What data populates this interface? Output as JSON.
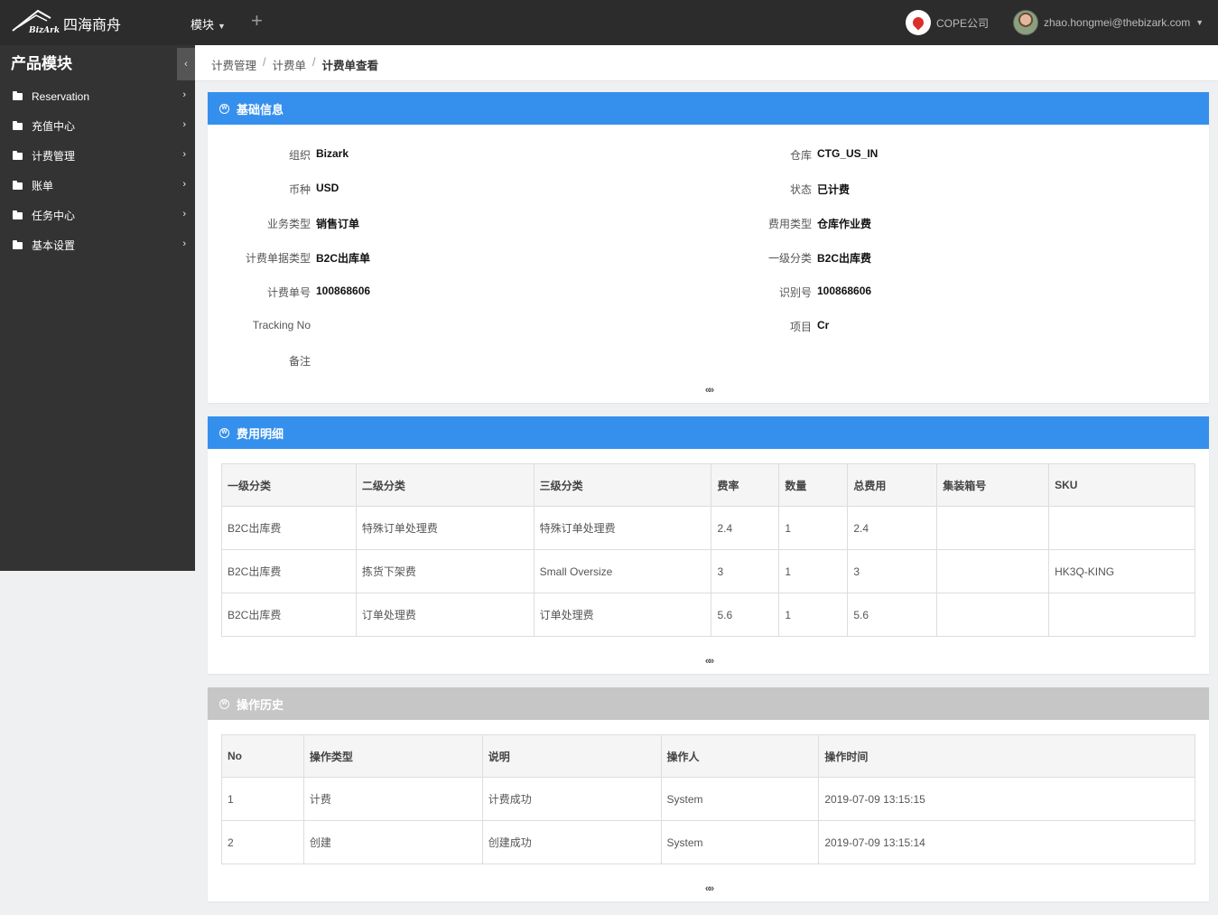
{
  "topbar": {
    "logo_brand": "BizArk",
    "logo_text": "四海商舟",
    "module_menu": "模块",
    "add_label": "+",
    "company": "COPE公司",
    "user_email": "zhao.hongmei@thebizark.com"
  },
  "sidebar": {
    "title": "产品模块",
    "collapse_label": "‹",
    "items": [
      {
        "label": "Reservation"
      },
      {
        "label": "充值中心"
      },
      {
        "label": "计费管理"
      },
      {
        "label": "账单"
      },
      {
        "label": "任务中心"
      },
      {
        "label": "基本设置"
      }
    ]
  },
  "breadcrumb": {
    "items": [
      "计费管理",
      "计费单"
    ],
    "current": "计费单查看",
    "separator": "/"
  },
  "basic_info": {
    "title": "基础信息",
    "left": [
      {
        "label": "组织",
        "value": "Bizark"
      },
      {
        "label": "币种",
        "value": "USD"
      },
      {
        "label": "业务类型",
        "value": "销售订单"
      },
      {
        "label": "计费单据类型",
        "value": "B2C出库单"
      },
      {
        "label": "计费单号",
        "value": "100868606"
      },
      {
        "label": "Tracking No",
        "value": ""
      },
      {
        "label": "备注",
        "value": ""
      }
    ],
    "right": [
      {
        "label": "仓库",
        "value": "CTG_US_IN"
      },
      {
        "label": "状态",
        "value": "已计费"
      },
      {
        "label": "费用类型",
        "value": "仓库作业费"
      },
      {
        "label": "一级分类",
        "value": "B2C出库费"
      },
      {
        "label": "识别号",
        "value": "100868606"
      },
      {
        "label": "项目",
        "value": "Cr"
      }
    ]
  },
  "fee_detail": {
    "title": "费用明细",
    "columns": [
      "一级分类",
      "二级分类",
      "三级分类",
      "费率",
      "数量",
      "总费用",
      "集装箱号",
      "SKU"
    ],
    "rows": [
      [
        "B2C出库费",
        "特殊订单处理费",
        "特殊订单处理费",
        "2.4",
        "1",
        "2.4",
        "",
        ""
      ],
      [
        "B2C出库费",
        "拣货下架费",
        "Small Oversize",
        "3",
        "1",
        "3",
        "",
        "HK3Q-KING"
      ],
      [
        "B2C出库费",
        "订单处理费",
        "订单处理费",
        "5.6",
        "1",
        "5.6",
        "",
        ""
      ]
    ]
  },
  "history": {
    "title": "操作历史",
    "columns": [
      "No",
      "操作类型",
      "说明",
      "操作人",
      "操作时间"
    ],
    "rows": [
      [
        "1",
        "计费",
        "计费成功",
        "System",
        "2019-07-09 13:15:15"
      ],
      [
        "2",
        "创建",
        "创建成功",
        "System",
        "2019-07-09 13:15:14"
      ]
    ]
  },
  "toggle_label": "«»",
  "colors": {
    "topbar": "#2c2c2c",
    "sidebar": "#333333",
    "panel_head_blue": "#3590ed",
    "panel_head_gray": "#c6c6c6"
  }
}
